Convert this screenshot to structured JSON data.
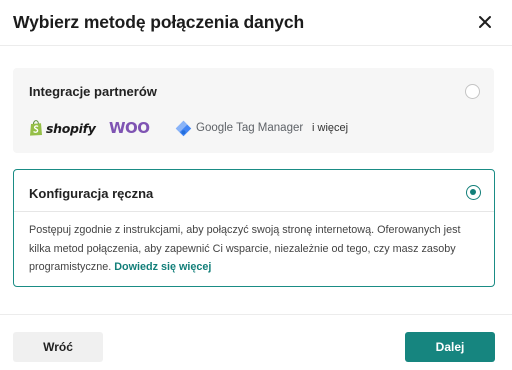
{
  "dialog": {
    "title": "Wybierz metodę połączenia danych",
    "close_icon": "close-icon"
  },
  "options": [
    {
      "label": "Integracje partnerów",
      "selected": false,
      "logos": {
        "shopify": "shopify",
        "woo": "WOO",
        "gtm": "Google Tag Manager",
        "more": "i więcej"
      }
    },
    {
      "label": "Konfiguracja ręczna",
      "selected": true,
      "description": "Postępuj zgodnie z instrukcjami, aby połączyć swoją stronę internetową. Oferowanych jest kilka metod połączenia, aby zapewnić Ci wsparcie, niezależnie od tego, czy masz zasoby programistyczne.",
      "link": "Dowiedz się więcej"
    }
  ],
  "footer": {
    "back_label": "Wróć",
    "next_label": "Dalej"
  },
  "colors": {
    "accent": "#16857f",
    "woo_purple": "#7f54b3",
    "shopify_green": "#95bf47"
  }
}
